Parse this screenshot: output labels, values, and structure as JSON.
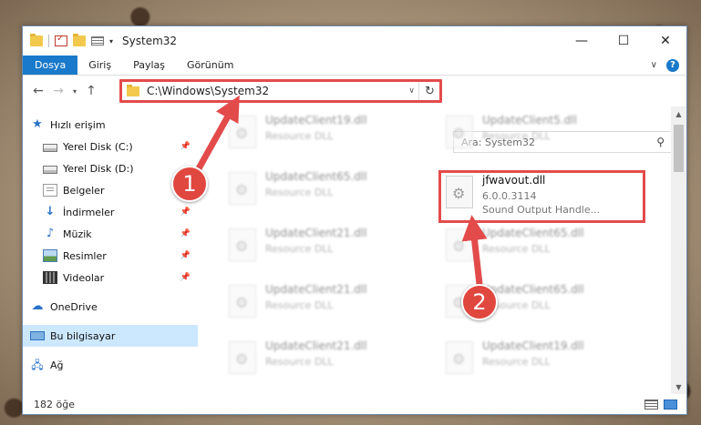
{
  "window": {
    "title": "System32",
    "controls": {
      "minimize": "—",
      "maximize": "☐",
      "close": "✕"
    }
  },
  "ribbon": {
    "tabs": [
      "Dosya",
      "Giriş",
      "Paylaş",
      "Görünüm"
    ],
    "help": "?"
  },
  "address": {
    "path": "C:\\Windows\\System32",
    "search_placeholder": "Ara: System32"
  },
  "nav": {
    "quick_access": "Hızlı erişim",
    "items": [
      {
        "label": "Yerel Disk (C:)",
        "icon": "drive-icon"
      },
      {
        "label": "Yerel Disk (D:)",
        "icon": "drive-icon"
      },
      {
        "label": "Belgeler",
        "icon": "documents-icon"
      },
      {
        "label": "İndirmeler",
        "icon": "downloads-icon"
      },
      {
        "label": "Müzik",
        "icon": "music-icon"
      },
      {
        "label": "Resimler",
        "icon": "pictures-icon"
      },
      {
        "label": "Videolar",
        "icon": "videos-icon"
      }
    ],
    "onedrive": "OneDrive",
    "this_pc": "Bu bilgisayar",
    "network": "Ağ"
  },
  "files": {
    "left_column": [
      {
        "name": "UpdateClient19.dll",
        "desc": "Resource DLL"
      },
      {
        "name": "UpdateClient65.dll",
        "desc": "Resource DLL"
      },
      {
        "name": "UpdateClient21.dll",
        "desc": "Resource DLL"
      },
      {
        "name": "UpdateClient21.dll",
        "desc": "Resource DLL"
      },
      {
        "name": "UpdateClient21.dll",
        "desc": "Resource DLL"
      }
    ],
    "right_column": [
      {
        "name": "UpdateClient5.dll",
        "desc": "Resource DLL"
      },
      {
        "name": "UpdateClient65.dll",
        "desc": "Resource DLL"
      },
      {
        "name": "UpdateClient65.dll",
        "desc": "Resource DLL"
      },
      {
        "name": "UpdateClient19.dll",
        "desc": "Resource DLL"
      }
    ],
    "highlighted": {
      "name": "jfwavout.dll",
      "version": "6.0.0.3114",
      "desc": "Sound Output Handle..."
    }
  },
  "status": {
    "count": "182 öğe"
  },
  "annotations": {
    "step1": "1",
    "step2": "2",
    "color": "#e34b4b"
  }
}
